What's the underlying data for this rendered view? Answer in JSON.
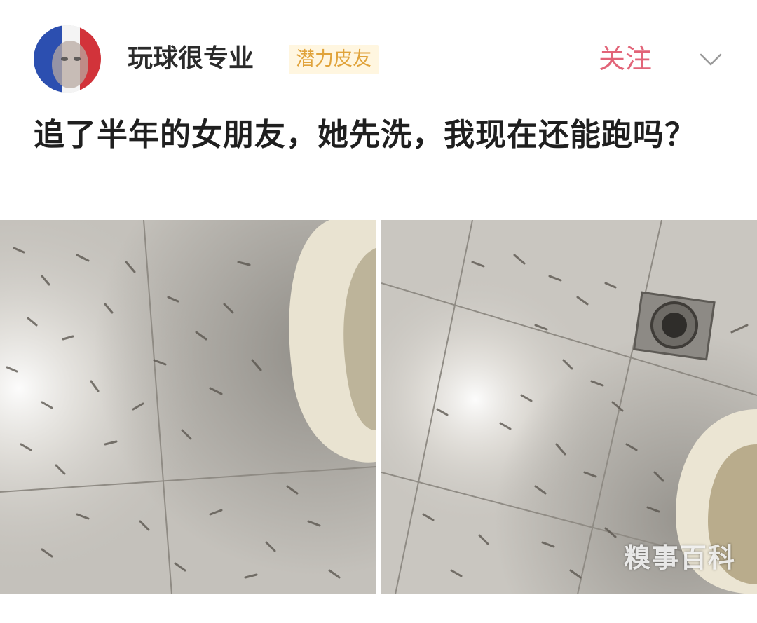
{
  "post": {
    "author": {
      "name": "玩球很专业",
      "badge": "潜力皮友",
      "avatar_icon": "avatar-portrait-tricolor"
    },
    "follow_label": "关注",
    "more_icon": "chevron-down-icon",
    "text": "追了半年的女朋友，她先洗，我现在还能跑吗？",
    "images": [
      {
        "name": "photo-bathroom-floor-left"
      },
      {
        "name": "photo-bathroom-floor-right"
      }
    ],
    "watermark": "糗事百科"
  },
  "colors": {
    "follow": "#e26478",
    "badge_text": "#e0a33b",
    "badge_bg": "#fff6e0",
    "username": "#2b2b2b"
  }
}
